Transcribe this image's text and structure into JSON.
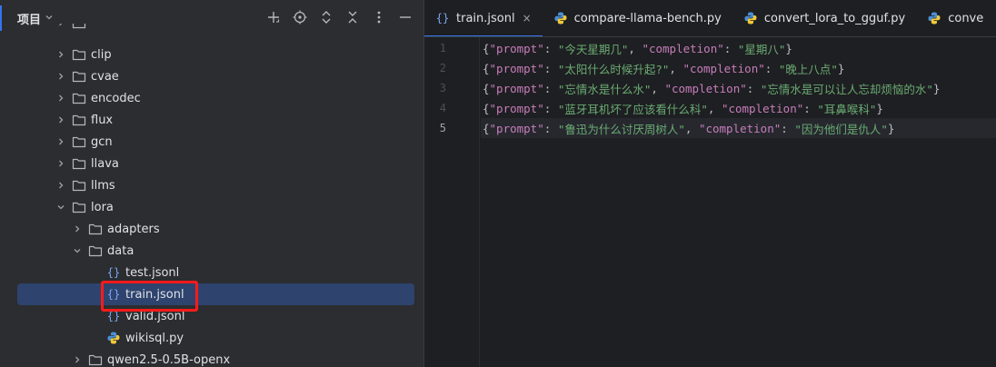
{
  "project": {
    "title": "项目",
    "tree": [
      {
        "label": "clip",
        "type": "folder",
        "level": 1,
        "expanded": false
      },
      {
        "label": "cvae",
        "type": "folder",
        "level": 1,
        "expanded": false
      },
      {
        "label": "encodec",
        "type": "folder",
        "level": 1,
        "expanded": false
      },
      {
        "label": "flux",
        "type": "folder",
        "level": 1,
        "expanded": false
      },
      {
        "label": "gcn",
        "type": "folder",
        "level": 1,
        "expanded": false
      },
      {
        "label": "llava",
        "type": "folder",
        "level": 1,
        "expanded": false
      },
      {
        "label": "llms",
        "type": "folder",
        "level": 1,
        "expanded": false
      },
      {
        "label": "lora",
        "type": "folder",
        "level": 1,
        "expanded": true
      },
      {
        "label": "adapters",
        "type": "folder",
        "level": 2,
        "expanded": false
      },
      {
        "label": "data",
        "type": "folder",
        "level": 2,
        "expanded": true
      },
      {
        "label": "test.jsonl",
        "type": "json",
        "level": 3
      },
      {
        "label": "train.jsonl",
        "type": "json",
        "level": 3,
        "selected": true
      },
      {
        "label": "valid.jsonl",
        "type": "json",
        "level": 3
      },
      {
        "label": "wikisql.py",
        "type": "python",
        "level": 3
      },
      {
        "label": "qwen2.5-0.5B-openx",
        "type": "folder",
        "level": 2,
        "expanded": false
      }
    ]
  },
  "editor": {
    "tabs": [
      {
        "label": "train.jsonl",
        "type": "json",
        "active": true
      },
      {
        "label": "compare-llama-bench.py",
        "type": "python"
      },
      {
        "label": "convert_lora_to_gguf.py",
        "type": "python"
      },
      {
        "label": "conve",
        "type": "python"
      }
    ],
    "lines": [
      {
        "num": "1",
        "prompt": "今天星期几",
        "completion": "星期八"
      },
      {
        "num": "2",
        "prompt": "太阳什么时候升起?",
        "completion": "晚上八点"
      },
      {
        "num": "3",
        "prompt": "忘情水是什么水",
        "completion": "忘情水是可以让人忘却烦恼的水"
      },
      {
        "num": "4",
        "prompt": "蓝牙耳机坏了应该看什么科",
        "completion": "耳鼻喉科"
      },
      {
        "num": "5",
        "prompt": "鲁迅为什么讨厌周树人",
        "completion": "因为他们是仇人"
      }
    ],
    "current_line": 5,
    "key_prompt": "\"prompt\"",
    "key_completion": "\"completion\""
  },
  "colors": {
    "accent": "#3574f0",
    "selection": "#2e436e",
    "highlight_box": "#ff1a1a",
    "json_key": "#c77dbb",
    "json_string": "#6aab73"
  }
}
